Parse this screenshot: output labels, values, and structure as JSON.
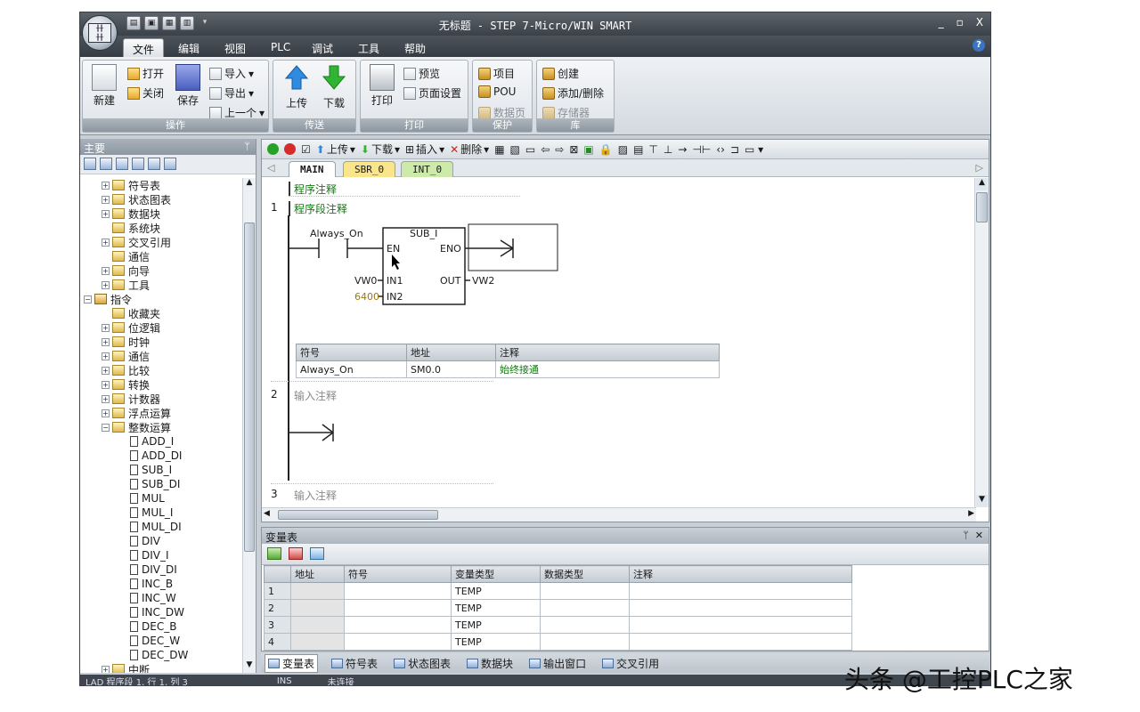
{
  "window": {
    "title": "无标题 - STEP 7-Micro/WIN SMART",
    "minimize": "_",
    "maximize": "▫",
    "close": "X"
  },
  "menu": [
    "文件",
    "编辑",
    "视图",
    "PLC",
    "调试",
    "工具",
    "帮助"
  ],
  "ribbon": {
    "new": "新建",
    "open": "打开",
    "close": "关闭",
    "save": "保存",
    "import": "导入",
    "export": "导出",
    "previous": "上一个",
    "upload": "上传",
    "download": "下载",
    "print": "打印",
    "preview": "预览",
    "page_setup": "页面设置",
    "project": "项目",
    "pou": "POU",
    "data_page": "数据页",
    "create": "创建",
    "add_delete": "添加/删除",
    "memory": "存储器",
    "groups": [
      "操作",
      "传送",
      "打印",
      "保护",
      "库"
    ]
  },
  "left_panel": {
    "title": "主要",
    "pin": "ᆨ",
    "tree": [
      {
        "label": "符号表",
        "level": 1,
        "exp": "+"
      },
      {
        "label": "状态图表",
        "level": 1,
        "exp": "+"
      },
      {
        "label": "数据块",
        "level": 1,
        "exp": "+"
      },
      {
        "label": "系统块",
        "level": 1,
        "exp": ""
      },
      {
        "label": "交叉引用",
        "level": 1,
        "exp": "+"
      },
      {
        "label": "通信",
        "level": 1,
        "exp": ""
      },
      {
        "label": "向导",
        "level": 1,
        "exp": "+"
      },
      {
        "label": "工具",
        "level": 1,
        "exp": "+"
      },
      {
        "label": "指令",
        "level": 0,
        "exp": "-"
      },
      {
        "label": "收藏夹",
        "level": 1,
        "exp": ""
      },
      {
        "label": "位逻辑",
        "level": 1,
        "exp": "+"
      },
      {
        "label": "时钟",
        "level": 1,
        "exp": "+"
      },
      {
        "label": "通信",
        "level": 1,
        "exp": "+"
      },
      {
        "label": "比较",
        "level": 1,
        "exp": "+"
      },
      {
        "label": "转换",
        "level": 1,
        "exp": "+"
      },
      {
        "label": "计数器",
        "level": 1,
        "exp": "+"
      },
      {
        "label": "浮点运算",
        "level": 1,
        "exp": "+"
      },
      {
        "label": "整数运算",
        "level": 1,
        "exp": "-"
      },
      {
        "label": "ADD_I",
        "level": 2,
        "exp": ""
      },
      {
        "label": "ADD_DI",
        "level": 2,
        "exp": ""
      },
      {
        "label": "SUB_I",
        "level": 2,
        "exp": ""
      },
      {
        "label": "SUB_DI",
        "level": 2,
        "exp": ""
      },
      {
        "label": "MUL",
        "level": 2,
        "exp": ""
      },
      {
        "label": "MUL_I",
        "level": 2,
        "exp": ""
      },
      {
        "label": "MUL_DI",
        "level": 2,
        "exp": ""
      },
      {
        "label": "DIV",
        "level": 2,
        "exp": ""
      },
      {
        "label": "DIV_I",
        "level": 2,
        "exp": ""
      },
      {
        "label": "DIV_DI",
        "level": 2,
        "exp": ""
      },
      {
        "label": "INC_B",
        "level": 2,
        "exp": ""
      },
      {
        "label": "INC_W",
        "level": 2,
        "exp": ""
      },
      {
        "label": "INC_DW",
        "level": 2,
        "exp": ""
      },
      {
        "label": "DEC_B",
        "level": 2,
        "exp": ""
      },
      {
        "label": "DEC_W",
        "level": 2,
        "exp": ""
      },
      {
        "label": "DEC_DW",
        "level": 2,
        "exp": ""
      },
      {
        "label": "中断",
        "level": 1,
        "exp": "+"
      }
    ]
  },
  "editor": {
    "toolbar": {
      "upload": "上传",
      "download": "下载",
      "insert": "插入",
      "delete": "删除"
    },
    "tabs": [
      "MAIN",
      "SBR_0",
      "INT_0"
    ],
    "program_comment": "程序注释",
    "networks": [
      {
        "number": "1",
        "comment": "程序段注释"
      },
      {
        "number": "2",
        "comment": "输入注释"
      },
      {
        "number": "3",
        "comment": "输入注释"
      }
    ],
    "ladder": {
      "contact": "Always_On",
      "box_name": "SUB_I",
      "en": "EN",
      "eno": "ENO",
      "in1": "IN1",
      "in2": "IN2",
      "out": "OUT",
      "in1_operand": "VW0",
      "in2_operand": "6400",
      "out_operand": "VW2"
    },
    "symbol_table": {
      "headers": [
        "符号",
        "地址",
        "注释"
      ],
      "row": [
        "Always_On",
        "SM0.0",
        "始终接通"
      ]
    }
  },
  "var_table": {
    "title": "变量表",
    "headers": [
      "",
      "地址",
      "符号",
      "变量类型",
      "数据类型",
      "注释"
    ],
    "rows": [
      [
        "1",
        "",
        "",
        "TEMP",
        "",
        ""
      ],
      [
        "2",
        "",
        "",
        "TEMP",
        "",
        ""
      ],
      [
        "3",
        "",
        "",
        "TEMP",
        "",
        ""
      ],
      [
        "4",
        "",
        "",
        "TEMP",
        "",
        ""
      ]
    ]
  },
  "bottom_tabs": [
    "变量表",
    "符号表",
    "状态图表",
    "数据块",
    "输出窗口",
    "交叉引用"
  ],
  "status": {
    "position": "LAD 程序段 1, 行 1, 列 3",
    "mode": "INS",
    "connection": "未连接"
  },
  "watermark": "头条 @工控PLC之家",
  "colors": {
    "titlebar": "#4a5158",
    "ribbon": "#e4e8ec",
    "comment_green": "#117a11",
    "tab_sbr": "#f9e58c",
    "tab_int": "#cdeaa8"
  }
}
